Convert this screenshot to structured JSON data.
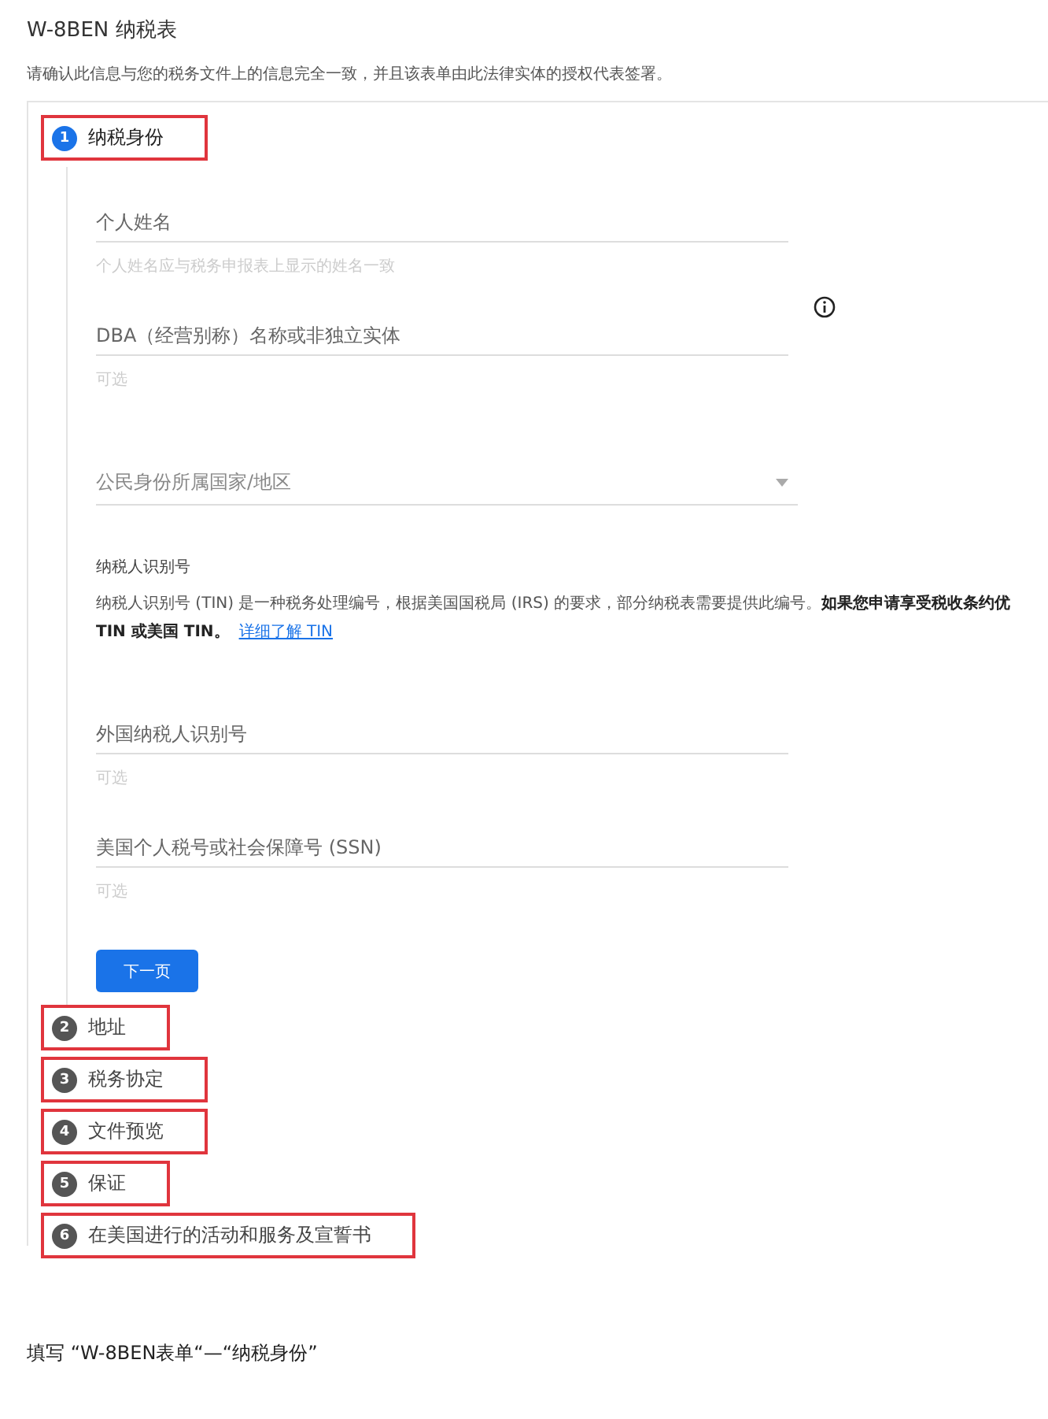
{
  "form": {
    "title": "W-8BEN 纳税表",
    "subtitle": "请确认此信息与您的税务文件上的信息完全一致，并且该表单由此法律实体的授权代表签署。",
    "steps": [
      {
        "number": "1",
        "label": "纳税身份",
        "selected": true,
        "annotated": true,
        "content": [
          {
            "kind": "text_field",
            "placeholder": "个人姓名",
            "helper": "个人姓名应与税务申报表上显示的姓名一致",
            "info": false
          },
          {
            "kind": "text_field",
            "placeholder": "DBA（经营别称）名称或非独立实体",
            "helper": "可选",
            "info": true
          },
          {
            "kind": "select_field",
            "placeholder": "公民身份所属国家/地区"
          },
          {
            "kind": "section",
            "title": "纳税人识别号",
            "paragraph": "纳税人识别号 (TIN) 是一种税务处理编号，根据美国国税局 (IRS) 的要求，部分纳税表需要提供此编号。**如果您申请享受税收条约优**\n**TIN 或美国 TIN。**",
            "link": "详细了解 TIN"
          },
          {
            "kind": "text_field",
            "placeholder": "外国纳税人识别号",
            "helper": "可选",
            "info": false
          },
          {
            "kind": "text_field",
            "placeholder": "美国个人税号或社会保障号 (SSN)",
            "helper": "可选",
            "info": false
          }
        ],
        "button": "下一页"
      },
      {
        "number": "2",
        "label": "地址",
        "selected": false,
        "annotated": true
      },
      {
        "number": "3",
        "label": "税务协定",
        "selected": false,
        "annotated": true
      },
      {
        "number": "4",
        "label": "文件预览",
        "selected": false,
        "annotated": true
      },
      {
        "number": "5",
        "label": "保证",
        "selected": false,
        "annotated": true
      },
      {
        "number": "6",
        "label": "在美国进行的活动和服务及宣誓书",
        "selected": false,
        "annotated": true
      }
    ]
  },
  "caption": "填写 “W-8BEN表单“—“纳税身份”"
}
